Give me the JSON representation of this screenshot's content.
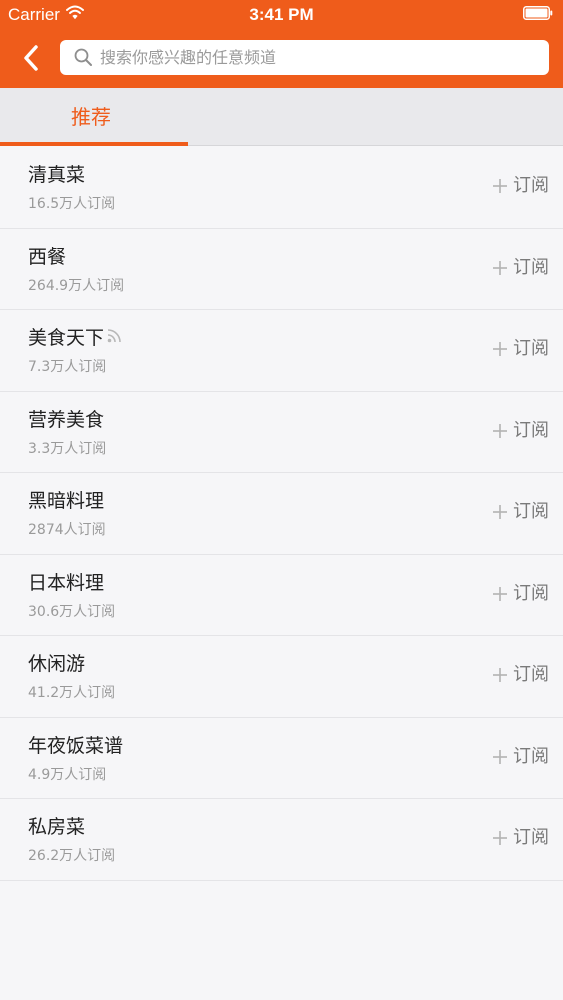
{
  "status_bar": {
    "carrier": "Carrier",
    "time": "3:41 PM",
    "icons": [
      "wifi-icon",
      "battery-icon"
    ]
  },
  "header": {
    "background": "#ef5c1b",
    "back_icon": "chevron-left-icon",
    "search": {
      "placeholder": "搜索你感兴趣的任意频道",
      "value": "",
      "icon": "search-icon"
    }
  },
  "tabs": [
    {
      "label": "推荐",
      "active": true
    }
  ],
  "accent_color": "#ef5c1b",
  "channels": [
    {
      "name": "清真菜",
      "subscribers": "16.5万人订阅",
      "action": "订阅",
      "rss": false
    },
    {
      "name": "西餐",
      "subscribers": "264.9万人订阅",
      "action": "订阅",
      "rss": false
    },
    {
      "name": "美食天下",
      "subscribers": "7.3万人订阅",
      "action": "订阅",
      "rss": true
    },
    {
      "name": "营养美食",
      "subscribers": "3.3万人订阅",
      "action": "订阅",
      "rss": false
    },
    {
      "name": "黑暗料理",
      "subscribers": "2874人订阅",
      "action": "订阅",
      "rss": false
    },
    {
      "name": "日本料理",
      "subscribers": "30.6万人订阅",
      "action": "订阅",
      "rss": false
    },
    {
      "name": "休闲游",
      "subscribers": "41.2万人订阅",
      "action": "订阅",
      "rss": false
    },
    {
      "name": "年夜饭菜谱",
      "subscribers": "4.9万人订阅",
      "action": "订阅",
      "rss": false
    },
    {
      "name": "私房菜",
      "subscribers": "26.2万人订阅",
      "action": "订阅",
      "rss": false
    }
  ]
}
